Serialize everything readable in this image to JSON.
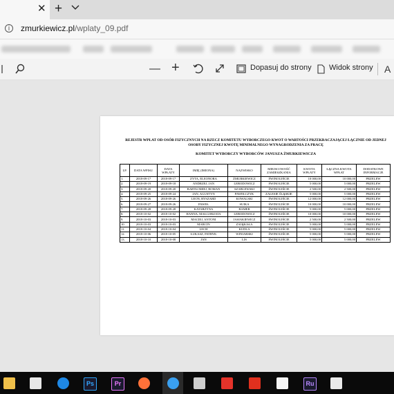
{
  "browser": {
    "tab_close_glyph": "✕",
    "new_tab_glyph": "+",
    "url_host": "zmurkiewicz.pl",
    "url_path": "/wplaty_09.pdf"
  },
  "pdf_toolbar": {
    "zoom_out_glyph": "—",
    "zoom_in_glyph": "+",
    "fit_page_label": "Dopasuj do strony",
    "page_view_label": "Widok strony"
  },
  "document": {
    "title": "REJESTR WPŁAT OD OSÓB FIZYCZNYCH NA RZECZ KOMITETU WYBORCZEGO KWOT O WARTOŚCI PRZEKRACZAJĄCEJ ŁĄCZNIE OD JEDNEJ OSOBY FIZYCZNEJ KWOTĘ MINIMALNEGO WYNAGRODZENIA ZA PRACĘ",
    "subtitle": "KOMITET WYBORCZY WYBORCÓW JANUSZA ŻMURKIEWICZA",
    "columns": [
      "LP.",
      "DATA WPISU",
      "DATA WPŁATY",
      "IMIĘ (IMIONA)",
      "NAZWISKO",
      "MIEJSCOWOŚĆ ZAMIESZKANIA",
      "KWOTA WPŁATY",
      "ŁĄCZNA KWOTA WPŁAT",
      "DODATKOWE INFORMACJE"
    ],
    "rows": [
      [
        "1.",
        "2018-09-17",
        "2018-09-17",
        "ZYTA, ELEONORA",
        "ŻMURKIEWICZ",
        "ŚWINOUJŚCIE",
        "10 000,00",
        "10 000,00",
        "PRZELEW"
      ],
      [
        "2.",
        "2018-09-19",
        "2018-09-18",
        "ANDRZEJ, JAN",
        "LEBODOWICZ",
        "ŚWINOUJŚCIE",
        "5 000,00",
        "5 000,00",
        "PRZELEW"
      ],
      [
        "3.",
        "2018-09-20",
        "2018-09-20",
        "BARTŁOMIEJ, ROMAN",
        "SZABLEWSKI",
        "ŚWINOUJŚCIE",
        "2 500,00",
        "2 500,00",
        "PRZELEW"
      ],
      [
        "4.",
        "2018-09-25",
        "2018-09-24",
        "JAN, AGUSTYN",
        "PAWEŁCZYK",
        "ZALESIE ŚLĄSKIE",
        "5 000,00",
        "5 000,00",
        "PRZELEW"
      ],
      [
        "5.",
        "2018-09-26",
        "2018-09-26",
        "LEON, RYSZARD",
        "KOWALSKI",
        "ŚWINOUJŚCIE",
        "12 000,00",
        "12 000,00",
        "PRZELEW"
      ],
      [
        "6.",
        "2018-09-27",
        "2018-09-26",
        "PAWEŁ",
        "SUIKA",
        "ŚWINOUJŚCIE",
        "10 000,00",
        "10 000,00",
        "PRZELEW"
      ],
      [
        "7.",
        "2018-09-28",
        "2018-09-28",
        "KATARZYNA",
        "RAMER",
        "ŚWINOUJŚCIE",
        "5 000,00",
        "5 000,00",
        "PRZELEW"
      ],
      [
        "8.",
        "2018-10-02",
        "2018-10-02",
        "HANNA, MAŁGORZATA",
        "LEBODOWICZ",
        "ŚWINOUJŚCIE",
        "10 000,00",
        "10 000,00",
        "PRZELEW"
      ],
      [
        "9.",
        "2018-10-03",
        "2018-10-03",
        "MACIEJ, ANTONI",
        "JASIAKIEWICZ",
        "ŚWINOUJŚCIE",
        "2 500,00",
        "2 500,00",
        "PRZELEW"
      ],
      [
        "10.",
        "2018-10-03",
        "2018-10-03",
        "MARCIN",
        "ZAJĄKAŁA",
        "ŚWINOUJŚCIE",
        "5 000,00",
        "5 000,00",
        "PRZELEW"
      ],
      [
        "11.",
        "2018-10-04",
        "2018-10-04",
        "LECH",
        "KUDLA",
        "ŚWINOUJŚCIE",
        "5 000,00",
        "5 000,00",
        "PRZELEW"
      ],
      [
        "12.",
        "2018-10-06",
        "2018-10-05",
        "ŁUKASZ, PATRYK",
        "WINIARSKI",
        "ŚWINOUJŚCIE",
        "5 000,00",
        "5 000,00",
        "PRZELEW"
      ],
      [
        "13.",
        "2018-10-10",
        "2018-10-08",
        "JAN",
        "LIS",
        "ŚWINOUJŚCIE",
        "5 000,00",
        "5 000,00",
        "PRZELEW"
      ]
    ]
  },
  "taskbar": {
    "apps": [
      {
        "name": "file-explorer",
        "label": "",
        "color": "#f0c04a"
      },
      {
        "name": "mail",
        "label": "",
        "color": "#e8e8e8"
      },
      {
        "name": "edge-beta",
        "label": "",
        "color": "#1e88e5"
      },
      {
        "name": "photoshop",
        "label": "Ps",
        "color": "#31a8ff"
      },
      {
        "name": "premiere",
        "label": "Pr",
        "color": "#ea77ff"
      },
      {
        "name": "firefox",
        "label": "",
        "color": "#ff7139"
      },
      {
        "name": "edge",
        "label": "",
        "color": "#3aa0f0"
      },
      {
        "name": "eye-app",
        "label": "",
        "color": "#cfcfcf"
      },
      {
        "name": "creative-cloud",
        "label": "",
        "color": "#e5332a"
      },
      {
        "name": "acrobat",
        "label": "",
        "color": "#e0301e"
      },
      {
        "name": "document",
        "label": "",
        "color": "#f5f5f5"
      },
      {
        "name": "rush",
        "label": "Ru",
        "color": "#b889ff"
      },
      {
        "name": "photos",
        "label": "",
        "color": "#eaeaea"
      }
    ]
  }
}
